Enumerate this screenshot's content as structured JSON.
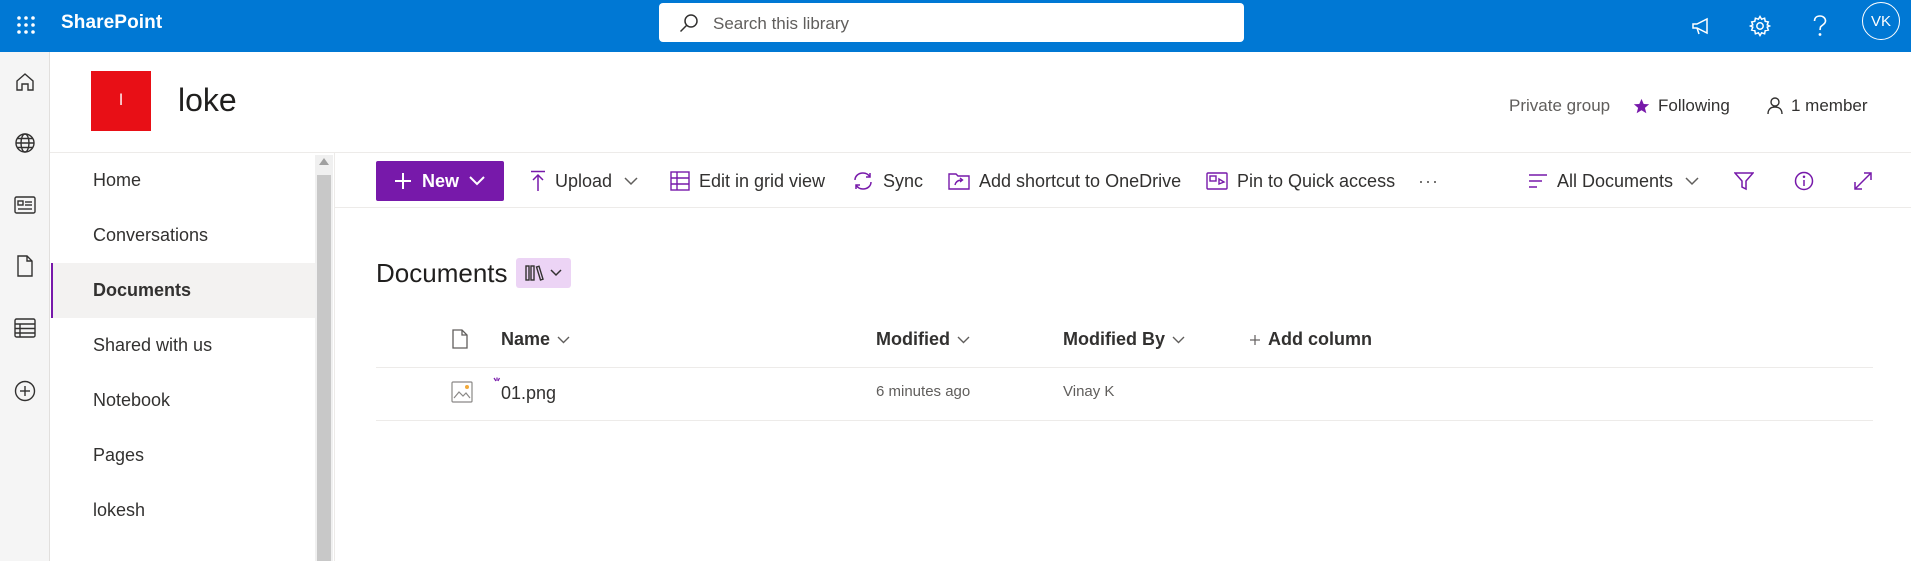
{
  "topbar": {
    "brand": "SharePoint",
    "search_placeholder": "Search this library",
    "avatar_initials": "VK",
    "color": "#0078d4"
  },
  "site": {
    "logo_letter": "l",
    "title": "loke",
    "privacy": "Private group",
    "following_label": "Following",
    "members_label": "1 member",
    "logo_color": "#e80f16"
  },
  "nav": {
    "items": [
      {
        "label": "Home"
      },
      {
        "label": "Conversations"
      },
      {
        "label": "Documents"
      },
      {
        "label": "Shared with us"
      },
      {
        "label": "Notebook"
      },
      {
        "label": "Pages"
      },
      {
        "label": "lokesh"
      }
    ],
    "selected": "Documents"
  },
  "commands": {
    "new_label": "New",
    "upload_label": "Upload",
    "edit_grid_label": "Edit in grid view",
    "sync_label": "Sync",
    "shortcut_label": "Add shortcut to OneDrive",
    "pin_label": "Pin to Quick access",
    "more_label": "···",
    "view_label": "All Documents",
    "accent": "#7719aa"
  },
  "library": {
    "title": "Documents",
    "columns": {
      "name": "Name",
      "modified": "Modified",
      "modified_by": "Modified By",
      "add_column": "Add column"
    },
    "rows": [
      {
        "name": "01.png",
        "modified": "6 minutes ago",
        "modified_by": "Vinay K"
      }
    ]
  },
  "icons": {
    "topbar": [
      "waffle-icon",
      "search-icon",
      "megaphone-icon",
      "gear-icon",
      "help-icon"
    ],
    "appbar": [
      "home-icon",
      "globe-icon",
      "news-icon",
      "file-icon",
      "lists-icon",
      "add-icon"
    ]
  }
}
